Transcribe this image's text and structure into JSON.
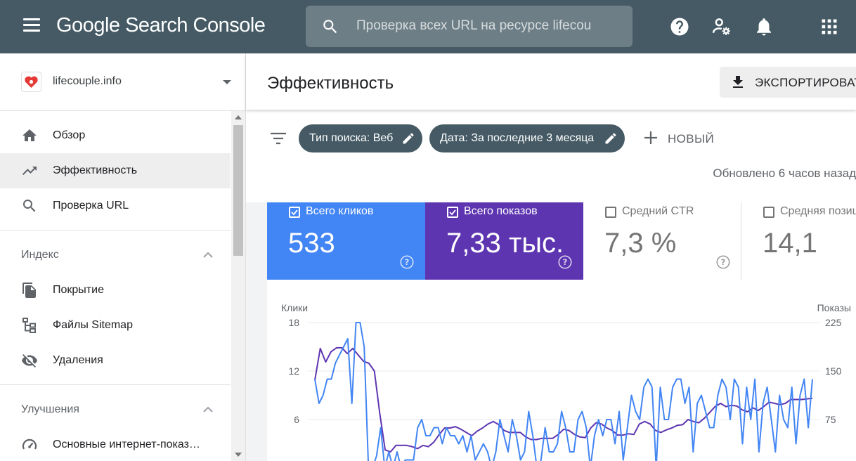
{
  "app": {
    "title": "Google Search Console"
  },
  "search": {
    "placeholder": "Проверка всех URL на ресурсе lifecou"
  },
  "top_icons": [
    "help-icon",
    "user-settings-icon",
    "notifications-icon",
    "apps-icon"
  ],
  "property": {
    "name": "lifecouple.info"
  },
  "sidebar": {
    "items": [
      {
        "label": "Обзор",
        "icon": "home-icon"
      },
      {
        "label": "Эффективность",
        "icon": "trending-up-icon",
        "active": true
      },
      {
        "label": "Проверка URL",
        "icon": "search-icon"
      }
    ],
    "sections": [
      {
        "label": "Индекс",
        "items": [
          {
            "label": "Покрытие",
            "icon": "coverage-icon"
          },
          {
            "label": "Файлы Sitemap",
            "icon": "sitemap-icon"
          },
          {
            "label": "Удаления",
            "icon": "removals-icon"
          }
        ]
      },
      {
        "label": "Улучшения",
        "items": [
          {
            "label": "Основные интернет-показ…",
            "icon": "web-vitals-icon"
          }
        ]
      }
    ]
  },
  "page": {
    "title": "Эффективность",
    "export_label": "ЭКСПОРТИРОВАТЬ"
  },
  "filters": {
    "chips": [
      "Тип поиска: Веб",
      "Дата: За последние 3 месяца"
    ],
    "new_label": "НОВЫЙ",
    "updated": "Обновлено 6 часов назад"
  },
  "metrics": [
    {
      "title": "Всего кликов",
      "value": "533",
      "selected": true,
      "color": "#4285f4"
    },
    {
      "title": "Всего показов",
      "value": "7,33 тыс.",
      "selected": true,
      "color": "#5e35b1"
    },
    {
      "title": "Средний CTR",
      "value": "7,3 %",
      "selected": false
    },
    {
      "title": "Средняя позиция",
      "value": "14,1",
      "selected": false
    }
  ],
  "colors": {
    "topbar": "#455a64",
    "clicks": "#4285f4",
    "impressions": "#5e35b1"
  },
  "chart_data": {
    "type": "line",
    "ylabel_left": "Клики",
    "ylabel_right": "Показы",
    "yticks_left": [
      "18",
      "12",
      "6"
    ],
    "yticks_right": [
      "225",
      "150",
      "75"
    ],
    "ylim_left": [
      0,
      18
    ],
    "ylim_right": [
      0,
      225
    ],
    "grid": true,
    "series": [
      {
        "name": "Клики",
        "axis": "left",
        "color": "#4285f4",
        "values": [
          11,
          8,
          9,
          11,
          11,
          13,
          14,
          15,
          16,
          8,
          18,
          18,
          15,
          0.5,
          0,
          1.5,
          5,
          0,
          2,
          0,
          2,
          0,
          1,
          1,
          1,
          5,
          6,
          4,
          4,
          5,
          5,
          3,
          5,
          4,
          4,
          3,
          4,
          2,
          4,
          1,
          2,
          3,
          2,
          0,
          2,
          6,
          4,
          2,
          6,
          4,
          1,
          2,
          7,
          4,
          0,
          1,
          5,
          2,
          2,
          3,
          7,
          5,
          2,
          2,
          6,
          7,
          5,
          0,
          4,
          6,
          4,
          6,
          6,
          3,
          7,
          1,
          5,
          9,
          7,
          6,
          10,
          11,
          10,
          0,
          10,
          6,
          6,
          10,
          11,
          11,
          8,
          10,
          2,
          8,
          9,
          7,
          5,
          5,
          9,
          11,
          10,
          6,
          11,
          10,
          3,
          10,
          6,
          11,
          2,
          8,
          10,
          6,
          2,
          9,
          6,
          5,
          10,
          3,
          9,
          11,
          5,
          11
        ]
      },
      {
        "name": "Показы",
        "axis": "right",
        "color": "#5e35b1",
        "values": [
          136,
          185,
          164,
          180,
          186,
          186,
          177,
          185,
          175,
          165,
          162,
          150,
          85,
          28,
          25,
          35,
          35,
          35,
          33,
          30,
          35,
          33,
          40,
          52,
          62,
          62,
          64,
          60,
          55,
          50,
          57,
          62,
          68,
          72,
          67,
          58,
          55,
          55,
          55,
          48,
          44,
          44,
          46,
          46,
          46,
          52,
          60,
          58,
          52,
          48,
          47,
          62,
          70,
          68,
          62,
          58,
          51,
          51,
          53,
          52,
          68,
          72,
          68,
          58,
          55,
          59,
          62,
          66,
          67,
          75,
          72,
          70,
          77,
          86,
          95,
          100,
          95,
          97,
          96,
          90,
          87,
          93,
          89,
          95,
          102,
          100,
          98,
          100,
          106,
          106,
          106,
          107,
          108
        ]
      }
    ]
  }
}
